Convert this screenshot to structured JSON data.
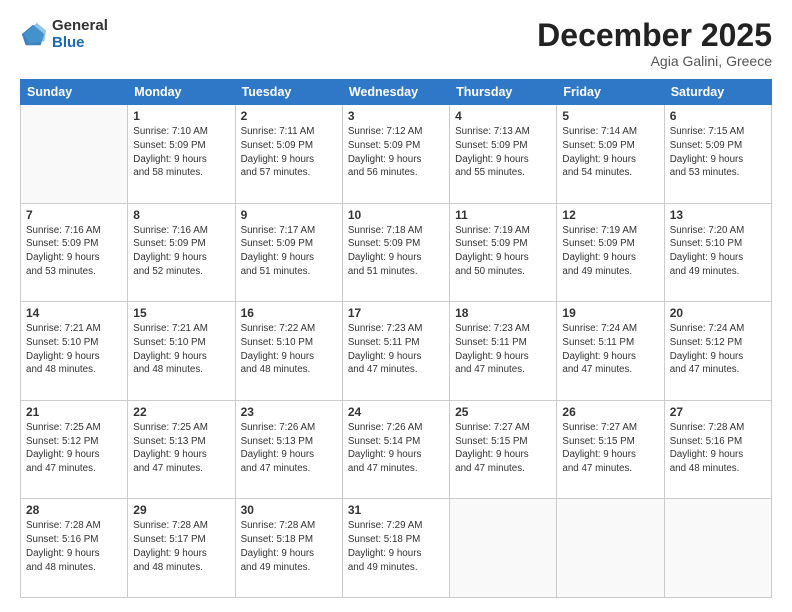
{
  "logo": {
    "general": "General",
    "blue": "Blue"
  },
  "header": {
    "month": "December 2025",
    "location": "Agia Galini, Greece"
  },
  "weekdays": [
    "Sunday",
    "Monday",
    "Tuesday",
    "Wednesday",
    "Thursday",
    "Friday",
    "Saturday"
  ],
  "weeks": [
    [
      {
        "day": "",
        "info": ""
      },
      {
        "day": "1",
        "info": "Sunrise: 7:10 AM\nSunset: 5:09 PM\nDaylight: 9 hours\nand 58 minutes."
      },
      {
        "day": "2",
        "info": "Sunrise: 7:11 AM\nSunset: 5:09 PM\nDaylight: 9 hours\nand 57 minutes."
      },
      {
        "day": "3",
        "info": "Sunrise: 7:12 AM\nSunset: 5:09 PM\nDaylight: 9 hours\nand 56 minutes."
      },
      {
        "day": "4",
        "info": "Sunrise: 7:13 AM\nSunset: 5:09 PM\nDaylight: 9 hours\nand 55 minutes."
      },
      {
        "day": "5",
        "info": "Sunrise: 7:14 AM\nSunset: 5:09 PM\nDaylight: 9 hours\nand 54 minutes."
      },
      {
        "day": "6",
        "info": "Sunrise: 7:15 AM\nSunset: 5:09 PM\nDaylight: 9 hours\nand 53 minutes."
      }
    ],
    [
      {
        "day": "7",
        "info": "Sunrise: 7:16 AM\nSunset: 5:09 PM\nDaylight: 9 hours\nand 53 minutes."
      },
      {
        "day": "8",
        "info": "Sunrise: 7:16 AM\nSunset: 5:09 PM\nDaylight: 9 hours\nand 52 minutes."
      },
      {
        "day": "9",
        "info": "Sunrise: 7:17 AM\nSunset: 5:09 PM\nDaylight: 9 hours\nand 51 minutes."
      },
      {
        "day": "10",
        "info": "Sunrise: 7:18 AM\nSunset: 5:09 PM\nDaylight: 9 hours\nand 51 minutes."
      },
      {
        "day": "11",
        "info": "Sunrise: 7:19 AM\nSunset: 5:09 PM\nDaylight: 9 hours\nand 50 minutes."
      },
      {
        "day": "12",
        "info": "Sunrise: 7:19 AM\nSunset: 5:09 PM\nDaylight: 9 hours\nand 49 minutes."
      },
      {
        "day": "13",
        "info": "Sunrise: 7:20 AM\nSunset: 5:10 PM\nDaylight: 9 hours\nand 49 minutes."
      }
    ],
    [
      {
        "day": "14",
        "info": "Sunrise: 7:21 AM\nSunset: 5:10 PM\nDaylight: 9 hours\nand 48 minutes."
      },
      {
        "day": "15",
        "info": "Sunrise: 7:21 AM\nSunset: 5:10 PM\nDaylight: 9 hours\nand 48 minutes."
      },
      {
        "day": "16",
        "info": "Sunrise: 7:22 AM\nSunset: 5:10 PM\nDaylight: 9 hours\nand 48 minutes."
      },
      {
        "day": "17",
        "info": "Sunrise: 7:23 AM\nSunset: 5:11 PM\nDaylight: 9 hours\nand 47 minutes."
      },
      {
        "day": "18",
        "info": "Sunrise: 7:23 AM\nSunset: 5:11 PM\nDaylight: 9 hours\nand 47 minutes."
      },
      {
        "day": "19",
        "info": "Sunrise: 7:24 AM\nSunset: 5:11 PM\nDaylight: 9 hours\nand 47 minutes."
      },
      {
        "day": "20",
        "info": "Sunrise: 7:24 AM\nSunset: 5:12 PM\nDaylight: 9 hours\nand 47 minutes."
      }
    ],
    [
      {
        "day": "21",
        "info": "Sunrise: 7:25 AM\nSunset: 5:12 PM\nDaylight: 9 hours\nand 47 minutes."
      },
      {
        "day": "22",
        "info": "Sunrise: 7:25 AM\nSunset: 5:13 PM\nDaylight: 9 hours\nand 47 minutes."
      },
      {
        "day": "23",
        "info": "Sunrise: 7:26 AM\nSunset: 5:13 PM\nDaylight: 9 hours\nand 47 minutes."
      },
      {
        "day": "24",
        "info": "Sunrise: 7:26 AM\nSunset: 5:14 PM\nDaylight: 9 hours\nand 47 minutes."
      },
      {
        "day": "25",
        "info": "Sunrise: 7:27 AM\nSunset: 5:15 PM\nDaylight: 9 hours\nand 47 minutes."
      },
      {
        "day": "26",
        "info": "Sunrise: 7:27 AM\nSunset: 5:15 PM\nDaylight: 9 hours\nand 47 minutes."
      },
      {
        "day": "27",
        "info": "Sunrise: 7:28 AM\nSunset: 5:16 PM\nDaylight: 9 hours\nand 48 minutes."
      }
    ],
    [
      {
        "day": "28",
        "info": "Sunrise: 7:28 AM\nSunset: 5:16 PM\nDaylight: 9 hours\nand 48 minutes."
      },
      {
        "day": "29",
        "info": "Sunrise: 7:28 AM\nSunset: 5:17 PM\nDaylight: 9 hours\nand 48 minutes."
      },
      {
        "day": "30",
        "info": "Sunrise: 7:28 AM\nSunset: 5:18 PM\nDaylight: 9 hours\nand 49 minutes."
      },
      {
        "day": "31",
        "info": "Sunrise: 7:29 AM\nSunset: 5:18 PM\nDaylight: 9 hours\nand 49 minutes."
      },
      {
        "day": "",
        "info": ""
      },
      {
        "day": "",
        "info": ""
      },
      {
        "day": "",
        "info": ""
      }
    ]
  ]
}
